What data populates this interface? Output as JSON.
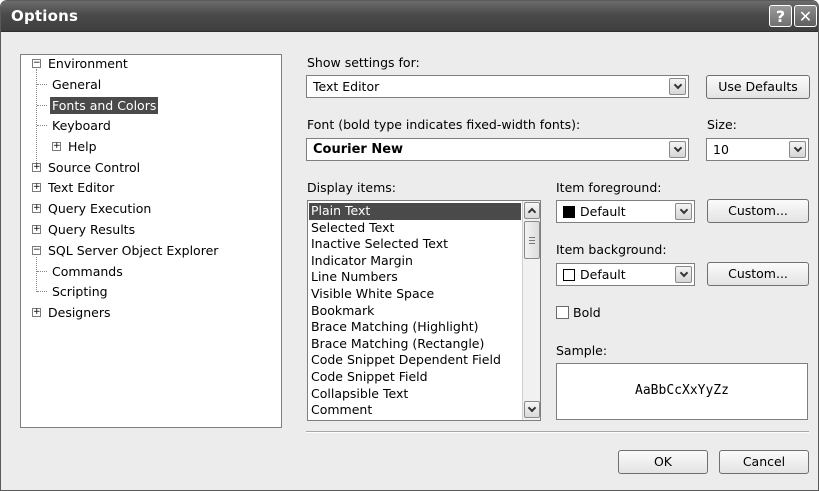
{
  "window": {
    "title": "Options",
    "help_glyph": "?",
    "close_glyph": "✕"
  },
  "tree": {
    "items": [
      {
        "label": "Environment",
        "expander": "−"
      },
      {
        "label": "General"
      },
      {
        "label": "Fonts and Colors"
      },
      {
        "label": "Keyboard"
      },
      {
        "label": "Help",
        "expander": "+"
      },
      {
        "label": "Source Control",
        "expander": "+"
      },
      {
        "label": "Text Editor",
        "expander": "+"
      },
      {
        "label": "Query Execution",
        "expander": "+"
      },
      {
        "label": "Query Results",
        "expander": "+"
      },
      {
        "label": "SQL Server Object Explorer",
        "expander": "−"
      },
      {
        "label": "Commands"
      },
      {
        "label": "Scripting"
      },
      {
        "label": "Designers",
        "expander": "+"
      }
    ],
    "selected": "Fonts and Colors"
  },
  "settings": {
    "show_for_label": "Show settings for:",
    "show_for_value": "Text Editor",
    "use_defaults": "Use Defaults",
    "font_label": "Font (bold type indicates fixed-width fonts):",
    "font_value": "Courier New",
    "size_label": "Size:",
    "size_value": "10"
  },
  "display_items": {
    "label": "Display items:",
    "items": [
      "Plain Text",
      "Selected Text",
      "Inactive Selected Text",
      "Indicator Margin",
      "Line Numbers",
      "Visible White Space",
      "Bookmark",
      "Brace Matching (Highlight)",
      "Brace Matching (Rectangle)",
      "Code Snippet Dependent Field",
      "Code Snippet Field",
      "Collapsible Text",
      "Comment"
    ],
    "selected": "Plain Text"
  },
  "foreground": {
    "label": "Item foreground:",
    "value": "Default",
    "swatch_color": "#000000",
    "custom": "Custom..."
  },
  "background": {
    "label": "Item background:",
    "value": "Default",
    "swatch_color": "#ffffff",
    "custom": "Custom..."
  },
  "bold": {
    "label": "Bold",
    "checked": false
  },
  "sample": {
    "label": "Sample:",
    "text": "AaBbCcXxYyZz"
  },
  "footer": {
    "ok": "OK",
    "cancel": "Cancel"
  },
  "colors": {
    "selection": "#4a4a4a",
    "dialog_bg": "#ececec",
    "titlebar": "#4a4a4a"
  }
}
